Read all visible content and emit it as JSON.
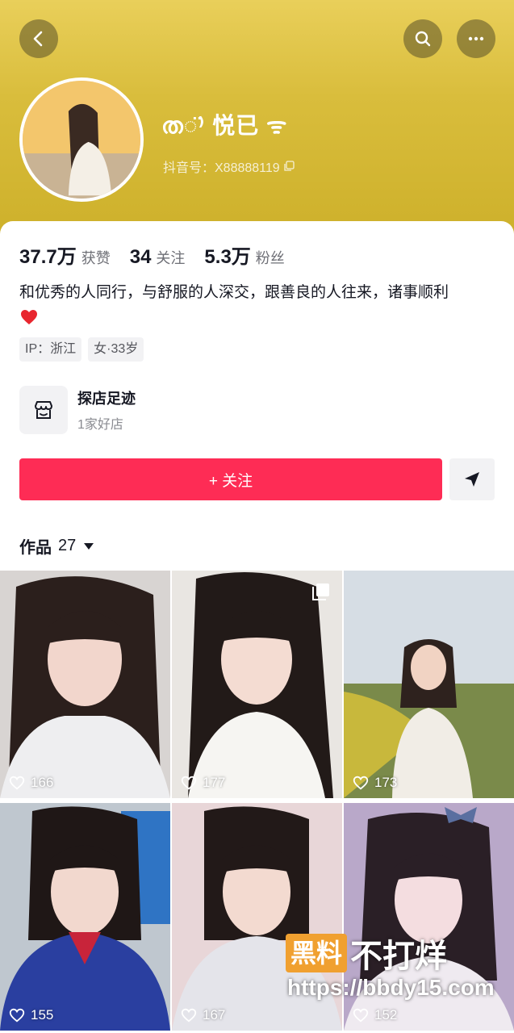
{
  "header": {
    "back_icon": "chevron-left-icon",
    "search_icon": "search-icon",
    "more_icon": "more-dots-icon",
    "bg_color": "#d9bd3c"
  },
  "profile": {
    "nickname": "ത◌̈⁾ 悦已 ᯤ",
    "douyin_id": "抖音号：X88888119"
  },
  "stats": [
    {
      "value": "37.7万",
      "label": "获赞"
    },
    {
      "value": "34",
      "label": "关注"
    },
    {
      "value": "5.3万",
      "label": "粉丝"
    }
  ],
  "bio": "和优秀的人同行，与舒服的人深交，跟善良的人往来，诸事顺利",
  "tags": [
    "IP：浙江",
    "女·33岁"
  ],
  "shop": {
    "title": "探店足迹",
    "subtitle": "1家好店"
  },
  "actions": {
    "follow_label": "+ 关注",
    "follow_color": "#fe2c55"
  },
  "works": {
    "label": "作品",
    "count": "27"
  },
  "videos": [
    {
      "likes": "166"
    },
    {
      "likes": "177"
    },
    {
      "likes": "173"
    },
    {
      "likes": "155"
    },
    {
      "likes": "167"
    },
    {
      "likes": "152"
    }
  ],
  "watermark": {
    "box_text": "黑料",
    "text": "不打烊",
    "url": "https://bbdy15.com"
  }
}
